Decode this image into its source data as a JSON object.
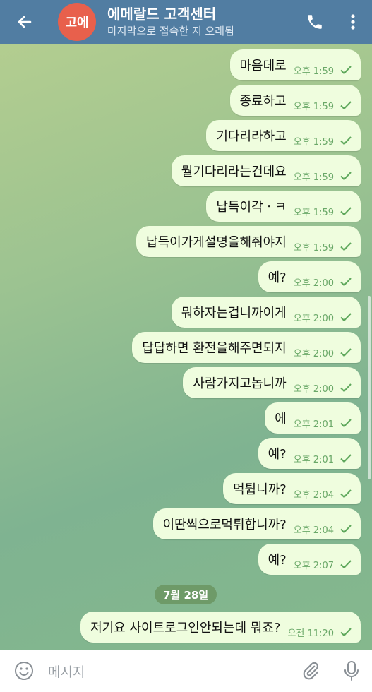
{
  "header": {
    "avatar_text": "고에",
    "title": "에메랄드 고객센터",
    "status": "마지막으로 접속한 지 오래됨",
    "colors": {
      "bar": "#517da2",
      "avatar": "#e8604c"
    }
  },
  "messages": [
    {
      "text": "마음데로",
      "time": "오후 1:59"
    },
    {
      "text": "종료하고",
      "time": "오후 1:59"
    },
    {
      "text": "기다리라하고",
      "time": "오후 1:59"
    },
    {
      "text": "뭘기다리라는건데요",
      "time": "오후 1:59"
    },
    {
      "text": "납득이각ㆍㅋ",
      "time": "오후 1:59"
    },
    {
      "text": "납득이가게설명을해줘야지",
      "time": "오후 1:59"
    },
    {
      "text": "예?",
      "time": "오후 2:00"
    },
    {
      "text": "뭐하자는겁니까이게",
      "time": "오후 2:00"
    },
    {
      "text": "답답하면 환전을해주면되지",
      "time": "오후 2:00"
    },
    {
      "text": "사람가지고놉니까",
      "time": "오후 2:00"
    },
    {
      "text": "에",
      "time": "오후 2:01"
    },
    {
      "text": "예?",
      "time": "오후 2:01"
    },
    {
      "text": "먹튑니까?",
      "time": "오후 2:04"
    },
    {
      "text": "이딴씩으로먹튀합니까?",
      "time": "오후 2:04"
    },
    {
      "text": "예?",
      "time": "오후 2:07"
    },
    {
      "text": "저기요 사이트로그인안되는데 뭐죠?",
      "time": "오전 11:20"
    }
  ],
  "date_separator": "7월 28일",
  "input": {
    "placeholder": "메시지"
  }
}
